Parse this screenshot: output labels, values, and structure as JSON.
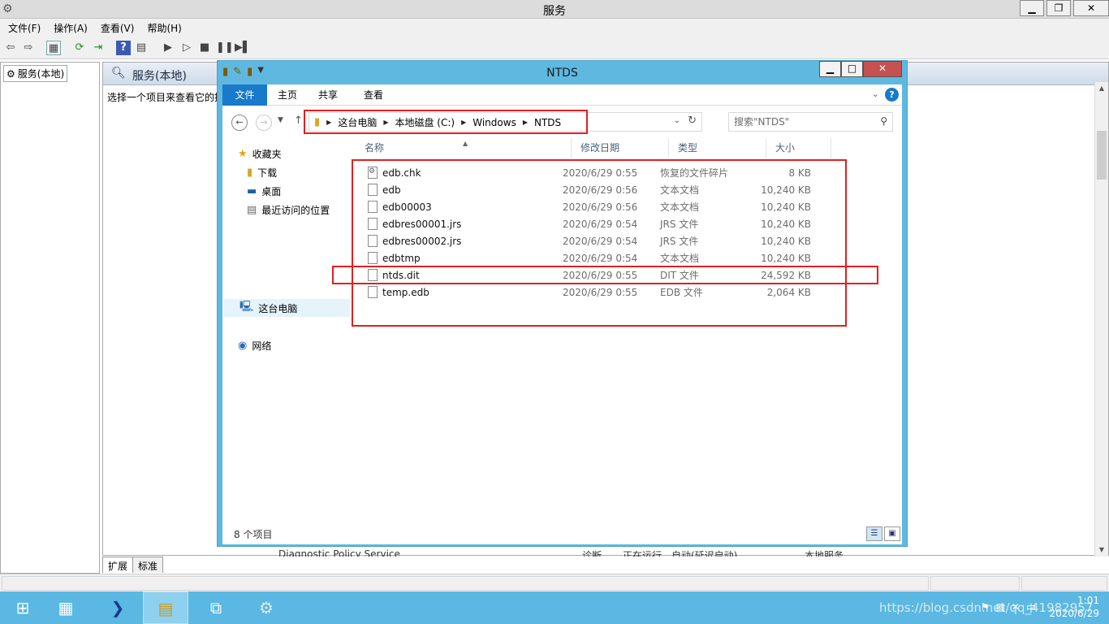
{
  "services_window": {
    "title": "服务",
    "win_controls": {
      "minimize": "▁",
      "restore": "❐",
      "close": "✕"
    },
    "menu": [
      "文件(F)",
      "操作(A)",
      "查看(V)",
      "帮助(H)"
    ],
    "tree_item": "服务(本地)",
    "main_title": "服务(本地)",
    "description": "选择一个项目来查看它的描述。",
    "partial_row": {
      "name": "Diagnostic Policy Service",
      "desc": "诊断...",
      "status": "正在运行",
      "startup": "自动(延迟启动)",
      "logon": "本地服务"
    },
    "tabs": [
      "扩展",
      "标准"
    ]
  },
  "explorer": {
    "title": "NTDS",
    "ribbon_tabs": {
      "file": "文件",
      "home": "主页",
      "share": "共享",
      "view": "查看"
    },
    "help": "?",
    "address": [
      "这台电脑",
      "本地磁盘 (C:)",
      "Windows",
      "NTDS"
    ],
    "search_placeholder": "搜索\"NTDS\"",
    "nav": {
      "favorites": "收藏夹",
      "downloads": "下载",
      "desktop": "桌面",
      "recent": "最近访问的位置",
      "this_pc": "这台电脑",
      "network": "网络"
    },
    "columns": {
      "name": "名称",
      "date": "修改日期",
      "type": "类型",
      "size": "大小"
    },
    "files": [
      {
        "name": "edb.chk",
        "date": "2020/6/29 0:55",
        "type": "恢复的文件碎片",
        "size": "8 KB",
        "icon": "chk"
      },
      {
        "name": "edb",
        "date": "2020/6/29 0:56",
        "type": "文本文档",
        "size": "10,240 KB",
        "icon": "doc"
      },
      {
        "name": "edb00003",
        "date": "2020/6/29 0:56",
        "type": "文本文档",
        "size": "10,240 KB",
        "icon": "doc"
      },
      {
        "name": "edbres00001.jrs",
        "date": "2020/6/29 0:54",
        "type": "JRS 文件",
        "size": "10,240 KB",
        "icon": "doc"
      },
      {
        "name": "edbres00002.jrs",
        "date": "2020/6/29 0:54",
        "type": "JRS 文件",
        "size": "10,240 KB",
        "icon": "doc"
      },
      {
        "name": "edbtmp",
        "date": "2020/6/29 0:54",
        "type": "文本文档",
        "size": "10,240 KB",
        "icon": "doc"
      },
      {
        "name": "ntds.dit",
        "date": "2020/6/29 0:55",
        "type": "DIT 文件",
        "size": "24,592 KB",
        "icon": "doc"
      },
      {
        "name": "temp.edb",
        "date": "2020/6/29 0:55",
        "type": "EDB 文件",
        "size": "2,064 KB",
        "icon": "doc"
      }
    ],
    "item_count": "8 个项目"
  },
  "taskbar": {
    "clock_time": "1:01",
    "clock_date": "2020/6/29",
    "tray_lang": "中",
    "watermark": "https://blog.csdn.net/qq_41982957"
  },
  "colors": {
    "explorer_frame": "#5fb8e0",
    "ribbon_file_tab": "#1979ca",
    "highlight_box": "#e02020",
    "taskbar": "#5ab8e2",
    "close_button": "#c75050"
  }
}
